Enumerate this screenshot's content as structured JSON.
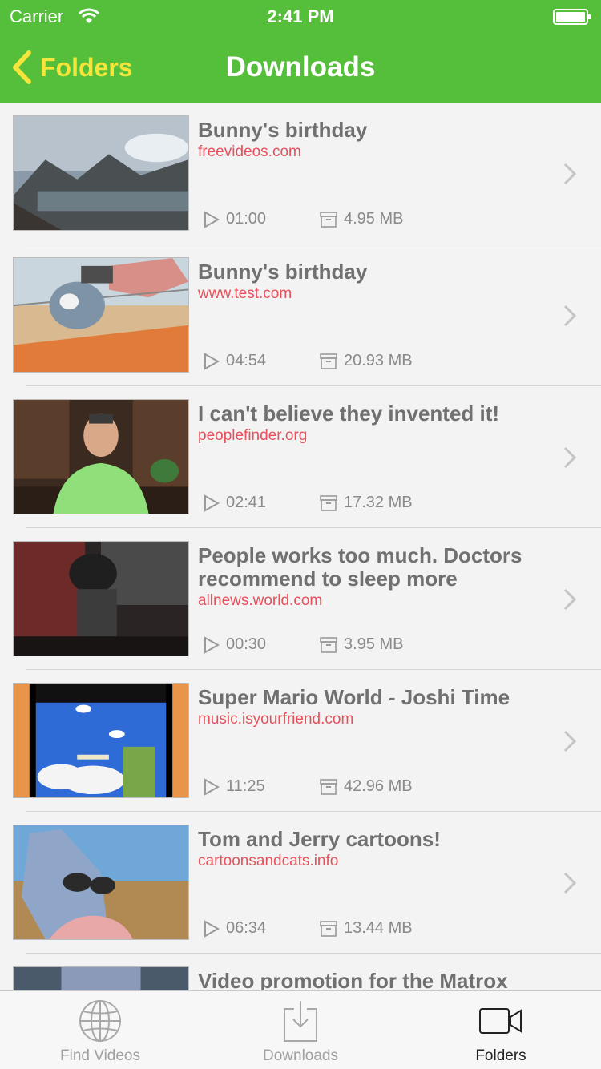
{
  "status_bar": {
    "carrier": "Carrier",
    "time": "2:41 PM"
  },
  "nav": {
    "back_label": "Folders",
    "title": "Downloads"
  },
  "videos": [
    {
      "title": "Bunny's birthday",
      "source": "freevideos.com",
      "duration": "01:00",
      "size": "4.95 MB"
    },
    {
      "title": "Bunny's birthday",
      "source": "www.test.com",
      "duration": "04:54",
      "size": "20.93 MB"
    },
    {
      "title": "I can't believe they invented it!",
      "source": "peoplefinder.org",
      "duration": "02:41",
      "size": "17.32 MB"
    },
    {
      "title": "People works too much. Doctors recommend to sleep more",
      "source": "allnews.world.com",
      "duration": "00:30",
      "size": "3.95 MB"
    },
    {
      "title": "Super Mario World - Joshi Time",
      "source": "music.isyourfriend.com",
      "duration": "11:25",
      "size": "42.96 MB"
    },
    {
      "title": "Tom and Jerry cartoons!",
      "source": "cartoonsandcats.info",
      "duration": "06:34",
      "size": "13.44 MB"
    },
    {
      "title": "Video promotion for the Matrox",
      "source": "",
      "duration": "",
      "size": ""
    }
  ],
  "tabs": [
    {
      "label": "Find Videos",
      "icon": "globe-icon"
    },
    {
      "label": "Downloads",
      "icon": "download-tray-icon"
    },
    {
      "label": "Folders",
      "icon": "video-camera-icon"
    }
  ],
  "colors": {
    "header": "#55bf3b",
    "back": "#f5e43a",
    "source": "#e8505b",
    "title": "#707070"
  }
}
